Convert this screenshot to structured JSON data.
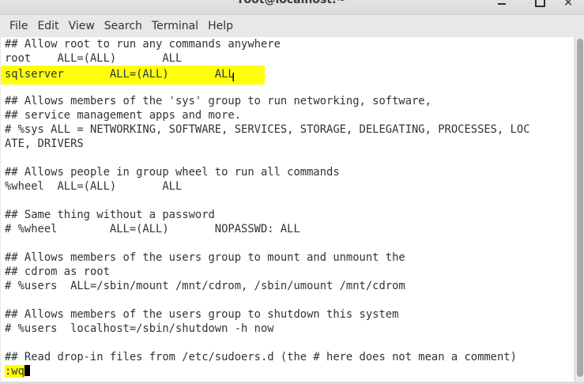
{
  "window": {
    "title": "root@localhost:~"
  },
  "menu": [
    "File",
    "Edit",
    "View",
    "Search",
    "Terminal",
    "Help"
  ],
  "terminal_lines": [
    "## Allow root to run any commands anywhere",
    "root    ALL=(ALL)       ALL",
    "sqlserver       ALL=(ALL)       ALL",
    "",
    "## Allows members of the 'sys' group to run networking, software,",
    "## service management apps and more.",
    "# %sys ALL = NETWORKING, SOFTWARE, SERVICES, STORAGE, DELEGATING, PROCESSES, LOC",
    "ATE, DRIVERS",
    "",
    "## Allows people in group wheel to run all commands",
    "%wheel  ALL=(ALL)       ALL",
    "",
    "## Same thing without a password",
    "# %wheel        ALL=(ALL)       NOPASSWD: ALL",
    "",
    "## Allows members of the users group to mount and unmount the",
    "## cdrom as root",
    "# %users  ALL=/sbin/mount /mnt/cdrom, /sbin/umount /mnt/cdrom",
    "",
    "## Allows members of the users group to shutdown this system",
    "# %users  localhost=/sbin/shutdown -h now",
    "",
    "## Read drop-in files from /etc/sudoers.d (the # here does not mean a comment)"
  ],
  "command_line": ":wq",
  "colors": {
    "highlight": "#ffff00",
    "text": "#2e3436",
    "background": "#ffffff"
  }
}
